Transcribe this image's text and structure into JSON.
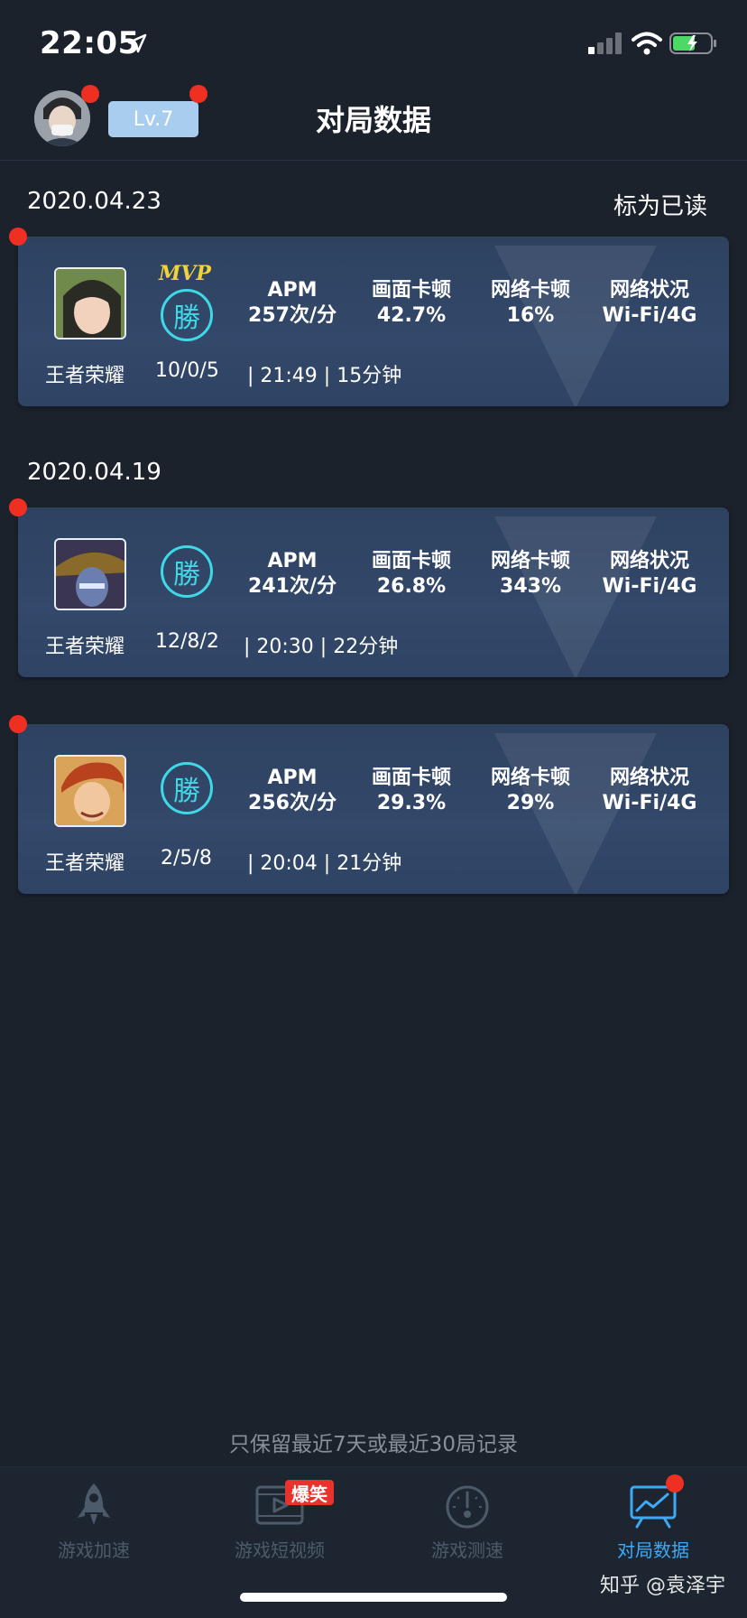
{
  "status_bar": {
    "time": "22:05"
  },
  "header": {
    "level": "Lv.7",
    "title": "对局数据"
  },
  "mark_read_label": "标为已读",
  "sections": [
    {
      "date": "2020.04.23",
      "cards": [
        {
          "mvp": "MVP",
          "result": "勝",
          "apm_label": "APM",
          "apm": "257次/分",
          "frame_label": "画面卡顿",
          "frame": "42.7%",
          "net_label": "网络卡顿",
          "net": "16%",
          "status_label": "网络状况",
          "status": "Wi-Fi/4G",
          "game": "王者荣耀",
          "kda": "10/0/5",
          "time": "| 21:49 | 15分钟"
        }
      ]
    },
    {
      "date": "2020.04.19",
      "cards": [
        {
          "result": "勝",
          "apm_label": "APM",
          "apm": "241次/分",
          "frame_label": "画面卡顿",
          "frame": "26.8%",
          "net_label": "网络卡顿",
          "net": "343%",
          "status_label": "网络状况",
          "status": "Wi-Fi/4G",
          "game": "王者荣耀",
          "kda": "12/8/2",
          "time": "| 20:30 | 22分钟"
        },
        {
          "result": "勝",
          "apm_label": "APM",
          "apm": "256次/分",
          "frame_label": "画面卡顿",
          "frame": "29.3%",
          "net_label": "网络卡顿",
          "net": "29%",
          "status_label": "网络状况",
          "status": "Wi-Fi/4G",
          "game": "王者荣耀",
          "kda": "2/5/8",
          "time": "| 20:04 | 21分钟"
        }
      ]
    }
  ],
  "retention_note": "只保留最近7天或最近30局记录",
  "tabs": [
    {
      "label": "游戏加速",
      "icon": "rocket-icon"
    },
    {
      "label": "游戏短视频",
      "icon": "video-icon",
      "badge": "爆笑"
    },
    {
      "label": "游戏测速",
      "icon": "speedometer-icon"
    },
    {
      "label": "对局数据",
      "icon": "chart-icon",
      "active": true
    }
  ],
  "watermark": "知乎 @袁泽宇",
  "colors": {
    "background": "#1b222c",
    "accent": "#3fa9f5",
    "win": "#3fd8e6",
    "alert": "#ef2f22",
    "mvp": "#f0d23c"
  }
}
